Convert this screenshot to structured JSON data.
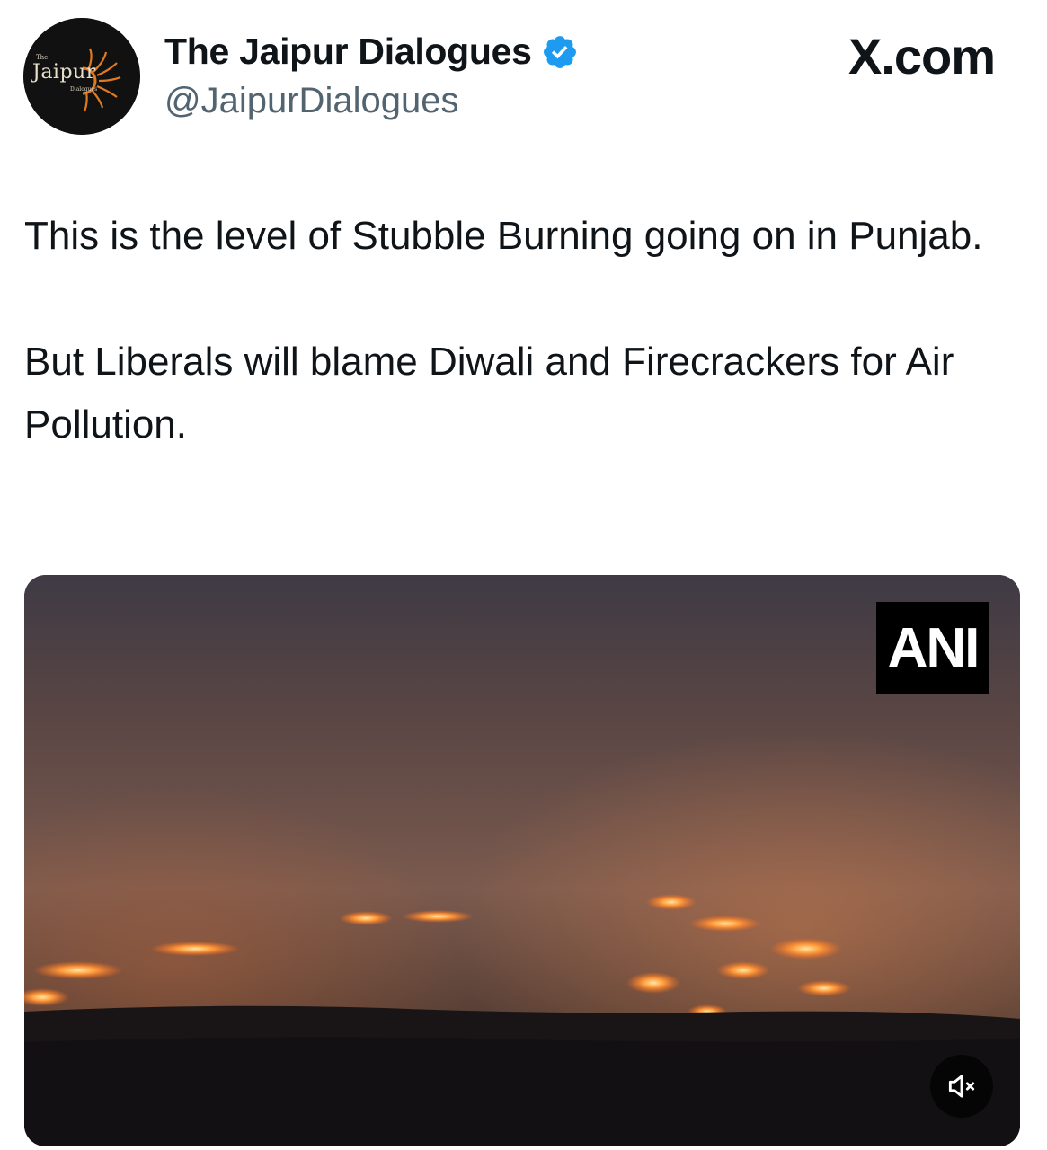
{
  "author": {
    "display_name": "The Jaipur Dialogues",
    "handle": "@JaipurDialogues",
    "avatar_logo": {
      "top": "The",
      "main": "Jaipur",
      "bottom": "Dialogues"
    },
    "verified": true
  },
  "brand": "X.com",
  "tweet": {
    "paragraphs": [
      "This is the level of Stubble Burning going on in Punjab.",
      "But Liberals will blame Diwali and Firecrackers for Air Pollution."
    ]
  },
  "media": {
    "type": "video",
    "watermark": "ANI",
    "muted": true,
    "icons": {
      "mute": "speaker-muted-icon"
    }
  },
  "colors": {
    "text": "#0f1419",
    "secondary_text": "#536471",
    "verified_blue": "#1d9bf0"
  }
}
